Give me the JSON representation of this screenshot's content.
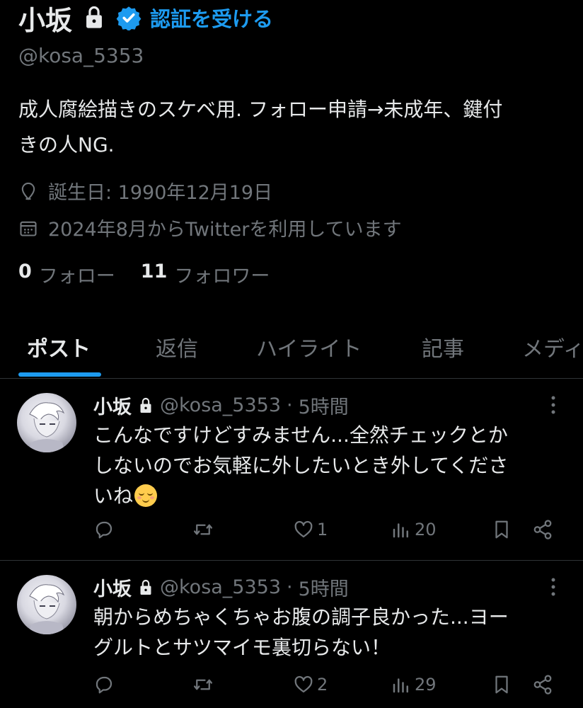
{
  "profile": {
    "display_name": "小坂",
    "get_verified": "認証を受ける",
    "handle": "@kosa_5353",
    "bio_line1": "成人腐絵描きのスケベ用. フォロー申請→未成年、鍵付",
    "bio_line2": "きの人NG.",
    "birthday": "誕生日: 1990年12月19日",
    "joined": "2024年8月からTwitterを利用しています",
    "following_count": "0",
    "following_label": "フォロー",
    "followers_count": "11",
    "followers_label": "フォロワー"
  },
  "tabs": [
    {
      "label": "ポスト",
      "active": true
    },
    {
      "label": "返信",
      "active": false
    },
    {
      "label": "ハイライト",
      "active": false
    },
    {
      "label": "記事",
      "active": false
    },
    {
      "label": "メディ",
      "active": false
    }
  ],
  "tweets": [
    {
      "name": "小坂",
      "handle": "@kosa_5353",
      "dot": "·",
      "time": "5時間",
      "text_line1": "こんなですけどすみません...全然チェックとか",
      "text_line2": "しないのでお気軽に外したいとき外してくださ",
      "text_line3": "いね",
      "emoji": "relieved-face",
      "likes": "1",
      "views": "20"
    },
    {
      "name": "小坂",
      "handle": "@kosa_5353",
      "dot": "·",
      "time": "5時間",
      "text_line1": "朝からめちゃくちゃお腹の調子良かった...ヨー",
      "text_line2": "グルトとサツマイモ裏切らない！",
      "likes": "2",
      "views": "29"
    }
  ],
  "icons": {
    "lock": "lock-icon",
    "verified": "verified-badge-icon",
    "location": "location-pin-icon",
    "calendar": "calendar-icon",
    "reply": "reply-icon",
    "retweet": "retweet-icon",
    "like": "heart-icon",
    "views": "views-icon",
    "bookmark": "bookmark-icon",
    "share": "share-icon",
    "more": "more-vertical-icon"
  },
  "colors": {
    "background": "#000000",
    "text": "#e7e9ea",
    "secondary": "#71767b",
    "accent": "#1d9bf0",
    "divider": "#2f3336"
  }
}
